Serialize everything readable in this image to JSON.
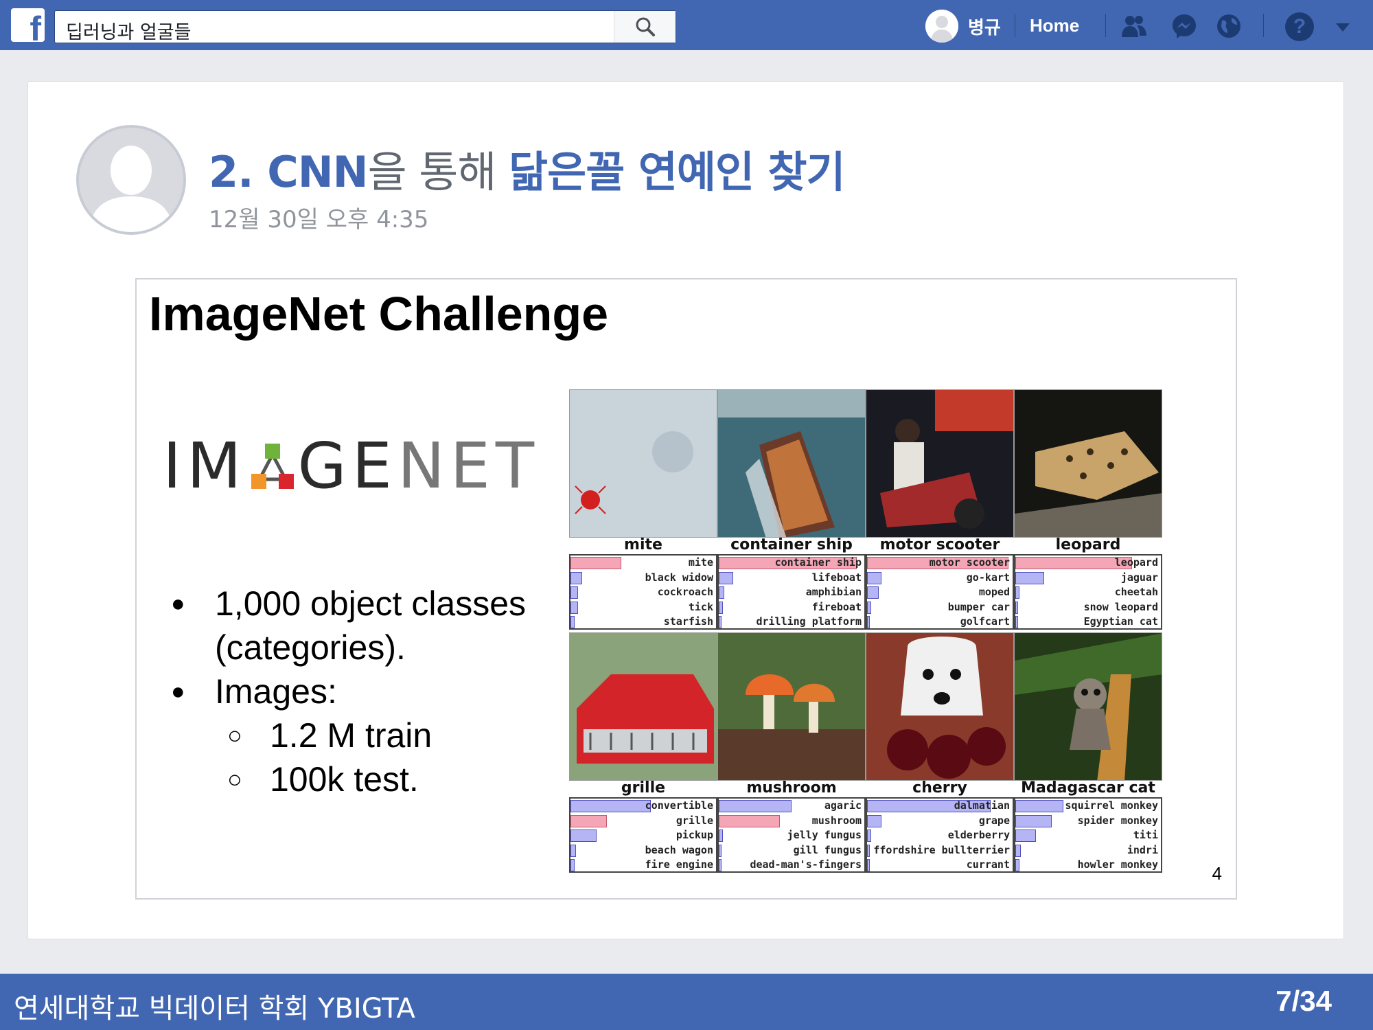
{
  "topbar": {
    "search_value": "딥러닝과 얼굴들",
    "user_name": "병규",
    "home_label": "Home",
    "help_label": "?"
  },
  "post": {
    "title_part1": "2. CNN",
    "title_part2": "을 통해 ",
    "title_part3": "닮은꼴 연예인 찾기",
    "timestamp": "12월 30일 오후 4:35"
  },
  "slide": {
    "title": "ImageNet Challenge",
    "logo_text_before": "IM",
    "logo_text_after_dark": "GE",
    "logo_text_after_light": "NET",
    "bullets": [
      {
        "text": "1,000 object classes",
        "continuation": "(categories)."
      },
      {
        "text": "Images:"
      }
    ],
    "sub_bullets": [
      "1.2 M train",
      "100k test."
    ],
    "page_number": "4",
    "bullet_glyph": "●",
    "sub_glyph": "○"
  },
  "grid": [
    {
      "label": "mite",
      "preds": [
        "mite",
        "black widow",
        "cockroach",
        "tick",
        "starfish"
      ],
      "bars": [
        0.35,
        0.08,
        0.05,
        0.05,
        0.03
      ],
      "hit": 0
    },
    {
      "label": "container ship",
      "preds": [
        "container ship",
        "lifeboat",
        "amphibian",
        "fireboat",
        "drilling platform"
      ],
      "bars": [
        0.95,
        0.1,
        0.04,
        0.03,
        0.02
      ],
      "hit": 0
    },
    {
      "label": "motor scooter",
      "preds": [
        "motor scooter",
        "go-kart",
        "moped",
        "bumper car",
        "golfcart"
      ],
      "bars": [
        0.97,
        0.1,
        0.08,
        0.03,
        0.02
      ],
      "hit": 0
    },
    {
      "label": "leopard",
      "preds": [
        "leopard",
        "jaguar",
        "cheetah",
        "snow leopard",
        "Egyptian cat"
      ],
      "bars": [
        0.8,
        0.2,
        0.03,
        0.02,
        0.02
      ],
      "hit": 0
    },
    {
      "label": "grille",
      "preds": [
        "convertible",
        "grille",
        "pickup",
        "beach wagon",
        "fire engine"
      ],
      "bars": [
        0.55,
        0.25,
        0.18,
        0.04,
        0.03
      ],
      "hit": 1
    },
    {
      "label": "mushroom",
      "preds": [
        "agaric",
        "mushroom",
        "jelly fungus",
        "gill fungus",
        "dead-man's-fingers"
      ],
      "bars": [
        0.5,
        0.42,
        0.03,
        0.02,
        0.02
      ],
      "hit": 1
    },
    {
      "label": "cherry",
      "preds": [
        "dalmatian",
        "grape",
        "elderberry",
        "ffordshire bullterrier",
        "currant"
      ],
      "bars": [
        0.85,
        0.1,
        0.03,
        0.02,
        0.02
      ],
      "hit": -1
    },
    {
      "label": "Madagascar cat",
      "preds": [
        "squirrel monkey",
        "spider monkey",
        "titi",
        "indri",
        "howler monkey"
      ],
      "bars": [
        0.33,
        0.25,
        0.14,
        0.04,
        0.03
      ],
      "hit": -1
    }
  ],
  "footer": {
    "left": "연세대학교 빅데이터 학회 YBIGTA",
    "right": "7/34"
  },
  "colors": {
    "facebook_blue": "#4267b2",
    "correct_bar": "#f4a6b6",
    "other_bar": "#b5b5f5"
  },
  "icons": [
    "facebook-logo-icon",
    "search-icon",
    "friends-icon",
    "messenger-icon",
    "globe-icon",
    "help-icon",
    "caret-down-icon"
  ]
}
